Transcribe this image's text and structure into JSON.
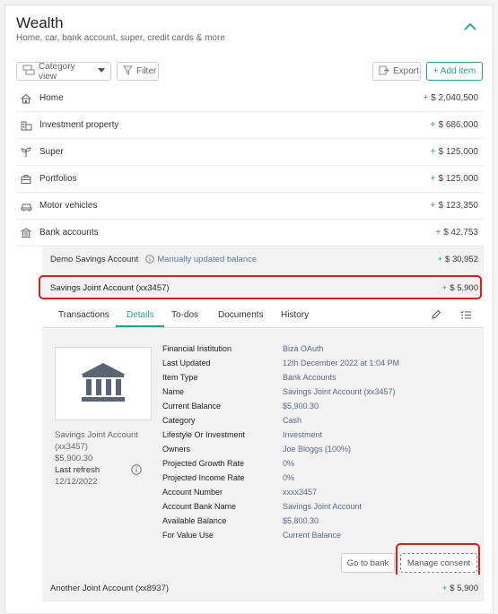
{
  "header": {
    "title": "Wealth",
    "subtitle": "Home, car, bank account, super, credit cards & more"
  },
  "toolbar": {
    "view_label": "Category view",
    "filter_label": "Filter",
    "export_label": "Export",
    "add_label": "+ Add item"
  },
  "categories": [
    {
      "label": "Home",
      "amount": "$ 2,040,500",
      "icon": "home-icon"
    },
    {
      "label": "Investment property",
      "amount": "$ 686,000",
      "icon": "building-icon"
    },
    {
      "label": "Super",
      "amount": "$ 125,000",
      "icon": "plant-icon"
    },
    {
      "label": "Portfolios",
      "amount": "$ 125,000",
      "icon": "briefcase-icon"
    },
    {
      "label": "Motor vehicles",
      "amount": "$ 123,350",
      "icon": "car-icon"
    },
    {
      "label": "Bank accounts",
      "amount": "$ 42,753",
      "icon": "bank-icon"
    }
  ],
  "accounts": {
    "demo": {
      "label": "Demo Savings Account",
      "note": "Manually updated balance",
      "amount": "$ 30,952"
    },
    "joint": {
      "label": "Savings Joint Account (xx3457)",
      "amount": "$ 5,900"
    },
    "another": {
      "label": "Another Joint Account (xx8937)",
      "amount": "$ 5,900"
    }
  },
  "tabs": [
    "Transactions",
    "Details",
    "To-dos",
    "Documents",
    "History"
  ],
  "active_tab": "Details",
  "summary": {
    "name": "Savings Joint Account (xx3457)",
    "balance": "$5,900.30",
    "last_refresh_label": "Last refresh",
    "last_refresh_date": "12/12/2022"
  },
  "details": [
    {
      "k": "Financial Institution",
      "v": "Biza OAuth"
    },
    {
      "k": "Last Updated",
      "v": "12th December 2022 at 1:04 PM"
    },
    {
      "k": "Item Type",
      "v": "Bank Accounts"
    },
    {
      "k": "Name",
      "v": "Savings Joint Account (xx3457)"
    },
    {
      "k": "Current Balance",
      "v": "$5,900.30"
    },
    {
      "k": "Category",
      "v": "Cash"
    },
    {
      "k": "Lifestyle Or Investment",
      "v": "Investment"
    },
    {
      "k": "Owners",
      "v": "Joe Bloggs (100%)"
    },
    {
      "k": "Projected Growth Rate",
      "v": "0%"
    },
    {
      "k": "Projected Income Rate",
      "v": "0%"
    },
    {
      "k": "Account Number",
      "v": "xxxx3457"
    },
    {
      "k": "Account Bank Name",
      "v": "Savings Joint Account"
    },
    {
      "k": "Available Balance",
      "v": "$5,800.30"
    },
    {
      "k": "For Value Use",
      "v": "Current Balance"
    }
  ],
  "actions": {
    "go_to_bank": "Go to bank",
    "manage_consent": "Manage consent"
  },
  "plus_sign": "+",
  "colors": {
    "accent": "#2a9d8f",
    "highlight": "#d62020"
  }
}
